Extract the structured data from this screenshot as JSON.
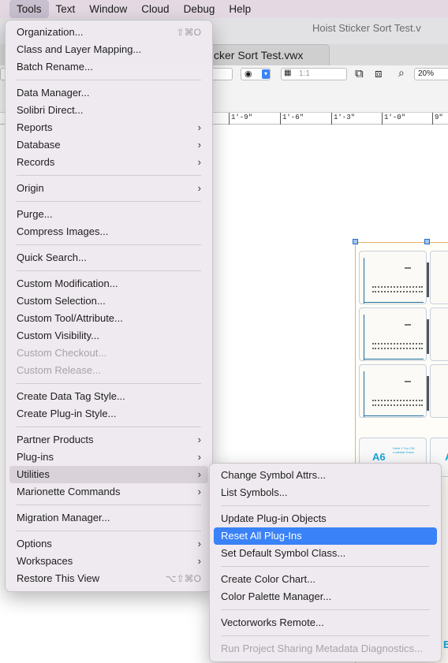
{
  "menubar": {
    "items": [
      "Tools",
      "Text",
      "Window",
      "Cloud",
      "Debug",
      "Help"
    ]
  },
  "window": {
    "title": "Hoist Sticker Sort Test.v",
    "tab_label": "cker Sort Test.vwx"
  },
  "toolbar": {
    "scale_value": "1:1",
    "zoom_value": "20%"
  },
  "ruler": {
    "ticks": [
      "1'-9\"",
      "1'-6\"",
      "1'-3\"",
      "1'-0\"",
      "9\""
    ]
  },
  "canvas": {
    "card_label": "A6",
    "card_label_partial": "A",
    "card_small_text": "Hoist 1 Ton CM Lodestar Down",
    "edge_label": "E"
  },
  "tools_menu": {
    "items": [
      {
        "label": "Organization...",
        "shortcut": "⇧⌘O"
      },
      {
        "label": "Class and Layer Mapping..."
      },
      {
        "label": "Batch Rename..."
      },
      {
        "sep": true
      },
      {
        "label": "Data Manager..."
      },
      {
        "label": "Solibri Direct..."
      },
      {
        "label": "Reports",
        "submenu": true
      },
      {
        "label": "Database",
        "submenu": true
      },
      {
        "label": "Records",
        "submenu": true
      },
      {
        "sep": true
      },
      {
        "label": "Origin",
        "submenu": true
      },
      {
        "sep": true
      },
      {
        "label": "Purge..."
      },
      {
        "label": "Compress Images..."
      },
      {
        "sep": true
      },
      {
        "label": "Quick Search..."
      },
      {
        "sep": true
      },
      {
        "label": "Custom Modification..."
      },
      {
        "label": "Custom Selection..."
      },
      {
        "label": "Custom Tool/Attribute..."
      },
      {
        "label": "Custom Visibility..."
      },
      {
        "label": "Custom Checkout...",
        "disabled": true
      },
      {
        "label": "Custom Release...",
        "disabled": true
      },
      {
        "sep": true
      },
      {
        "label": "Create Data Tag Style..."
      },
      {
        "label": "Create Plug-in Style..."
      },
      {
        "sep": true
      },
      {
        "label": "Partner Products",
        "submenu": true
      },
      {
        "label": "Plug-ins",
        "submenu": true
      },
      {
        "label": "Utilities",
        "submenu": true,
        "highlighted": true
      },
      {
        "label": "Marionette Commands",
        "submenu": true
      },
      {
        "sep": true
      },
      {
        "label": "Migration Manager..."
      },
      {
        "sep": true
      },
      {
        "label": "Options",
        "submenu": true
      },
      {
        "label": "Workspaces",
        "submenu": true
      },
      {
        "label": "Restore This View",
        "shortcut": "⌥⇧⌘O"
      }
    ]
  },
  "utilities_menu": {
    "items": [
      {
        "label": "Change Symbol Attrs..."
      },
      {
        "label": "List Symbols..."
      },
      {
        "sep": true
      },
      {
        "label": "Update Plug-in Objects"
      },
      {
        "label": "Reset All Plug-Ins",
        "selected": true
      },
      {
        "label": "Set Default Symbol Class..."
      },
      {
        "sep": true
      },
      {
        "label": "Create Color Chart..."
      },
      {
        "label": "Color Palette Manager..."
      },
      {
        "sep": true
      },
      {
        "label": "Vectorworks Remote..."
      },
      {
        "sep": true
      },
      {
        "label": "Run Project Sharing Metadata Diagnostics...",
        "disabled": true
      }
    ]
  },
  "colors": {
    "menubar_bg": "#e4d9e3",
    "selection": "#3a82f7",
    "card_line": "#1f6e9e",
    "label_cyan": "#1aa6d9"
  }
}
